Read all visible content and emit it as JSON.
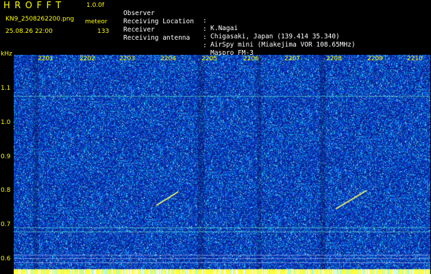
{
  "header": {
    "app_title": "HROFFT",
    "app_version": "1.0.0f",
    "file_name": "KN9_2508262200.png",
    "mode_label": "meteor",
    "datetime": "25.08.26 22:00",
    "count": "133"
  },
  "info": [
    {
      "label": "Observer",
      "sep": ":",
      "value": "K.Nagai"
    },
    {
      "label": "Receiving Location",
      "sep": ":",
      "value": "Chigasaki, Japan (139.414 35.340)"
    },
    {
      "label": "Receiver",
      "sep": ":",
      "value": "AirSpy mini (Miakejima VOR 108.65MHz)"
    },
    {
      "label": "Receiving antenna",
      "sep": ":",
      "value": "Maspro FM-3"
    }
  ],
  "axis": {
    "freq_unit": "kHz",
    "freq_ticks": [
      "1.1",
      "1.0",
      "0.9",
      "0.8",
      "0.7",
      "0.6"
    ],
    "time_ticks": [
      "2201",
      "2202",
      "2203",
      "2204",
      "2205",
      "2206",
      "2207",
      "2208",
      "2209",
      "2210"
    ]
  },
  "colors": {
    "background": "#000000",
    "header_text": "#ffff00",
    "info_text": "#ffffff",
    "noise_base": "#0a1ea8",
    "noise_bright": "#00c8ff",
    "signal": "#ffff40"
  }
}
